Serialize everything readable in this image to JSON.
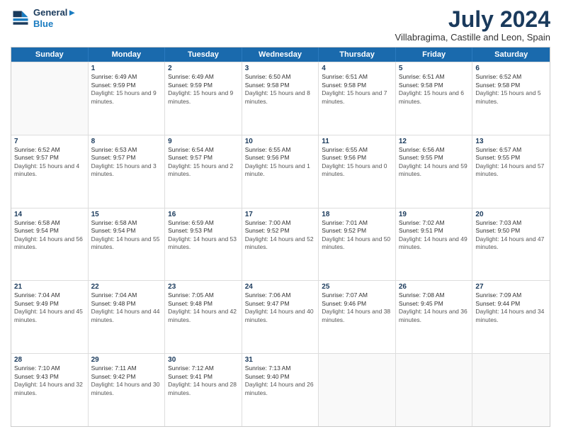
{
  "logo": {
    "line1": "General",
    "line2": "Blue"
  },
  "title": "July 2024",
  "subtitle": "Villabragima, Castille and Leon, Spain",
  "headers": [
    "Sunday",
    "Monday",
    "Tuesday",
    "Wednesday",
    "Thursday",
    "Friday",
    "Saturday"
  ],
  "weeks": [
    [
      {
        "day": "",
        "sunrise": "",
        "sunset": "",
        "daylight": ""
      },
      {
        "day": "1",
        "sunrise": "Sunrise: 6:49 AM",
        "sunset": "Sunset: 9:59 PM",
        "daylight": "Daylight: 15 hours and 9 minutes."
      },
      {
        "day": "2",
        "sunrise": "Sunrise: 6:49 AM",
        "sunset": "Sunset: 9:59 PM",
        "daylight": "Daylight: 15 hours and 9 minutes."
      },
      {
        "day": "3",
        "sunrise": "Sunrise: 6:50 AM",
        "sunset": "Sunset: 9:58 PM",
        "daylight": "Daylight: 15 hours and 8 minutes."
      },
      {
        "day": "4",
        "sunrise": "Sunrise: 6:51 AM",
        "sunset": "Sunset: 9:58 PM",
        "daylight": "Daylight: 15 hours and 7 minutes."
      },
      {
        "day": "5",
        "sunrise": "Sunrise: 6:51 AM",
        "sunset": "Sunset: 9:58 PM",
        "daylight": "Daylight: 15 hours and 6 minutes."
      },
      {
        "day": "6",
        "sunrise": "Sunrise: 6:52 AM",
        "sunset": "Sunset: 9:58 PM",
        "daylight": "Daylight: 15 hours and 5 minutes."
      }
    ],
    [
      {
        "day": "7",
        "sunrise": "Sunrise: 6:52 AM",
        "sunset": "Sunset: 9:57 PM",
        "daylight": "Daylight: 15 hours and 4 minutes."
      },
      {
        "day": "8",
        "sunrise": "Sunrise: 6:53 AM",
        "sunset": "Sunset: 9:57 PM",
        "daylight": "Daylight: 15 hours and 3 minutes."
      },
      {
        "day": "9",
        "sunrise": "Sunrise: 6:54 AM",
        "sunset": "Sunset: 9:57 PM",
        "daylight": "Daylight: 15 hours and 2 minutes."
      },
      {
        "day": "10",
        "sunrise": "Sunrise: 6:55 AM",
        "sunset": "Sunset: 9:56 PM",
        "daylight": "Daylight: 15 hours and 1 minute."
      },
      {
        "day": "11",
        "sunrise": "Sunrise: 6:55 AM",
        "sunset": "Sunset: 9:56 PM",
        "daylight": "Daylight: 15 hours and 0 minutes."
      },
      {
        "day": "12",
        "sunrise": "Sunrise: 6:56 AM",
        "sunset": "Sunset: 9:55 PM",
        "daylight": "Daylight: 14 hours and 59 minutes."
      },
      {
        "day": "13",
        "sunrise": "Sunrise: 6:57 AM",
        "sunset": "Sunset: 9:55 PM",
        "daylight": "Daylight: 14 hours and 57 minutes."
      }
    ],
    [
      {
        "day": "14",
        "sunrise": "Sunrise: 6:58 AM",
        "sunset": "Sunset: 9:54 PM",
        "daylight": "Daylight: 14 hours and 56 minutes."
      },
      {
        "day": "15",
        "sunrise": "Sunrise: 6:58 AM",
        "sunset": "Sunset: 9:54 PM",
        "daylight": "Daylight: 14 hours and 55 minutes."
      },
      {
        "day": "16",
        "sunrise": "Sunrise: 6:59 AM",
        "sunset": "Sunset: 9:53 PM",
        "daylight": "Daylight: 14 hours and 53 minutes."
      },
      {
        "day": "17",
        "sunrise": "Sunrise: 7:00 AM",
        "sunset": "Sunset: 9:52 PM",
        "daylight": "Daylight: 14 hours and 52 minutes."
      },
      {
        "day": "18",
        "sunrise": "Sunrise: 7:01 AM",
        "sunset": "Sunset: 9:52 PM",
        "daylight": "Daylight: 14 hours and 50 minutes."
      },
      {
        "day": "19",
        "sunrise": "Sunrise: 7:02 AM",
        "sunset": "Sunset: 9:51 PM",
        "daylight": "Daylight: 14 hours and 49 minutes."
      },
      {
        "day": "20",
        "sunrise": "Sunrise: 7:03 AM",
        "sunset": "Sunset: 9:50 PM",
        "daylight": "Daylight: 14 hours and 47 minutes."
      }
    ],
    [
      {
        "day": "21",
        "sunrise": "Sunrise: 7:04 AM",
        "sunset": "Sunset: 9:49 PM",
        "daylight": "Daylight: 14 hours and 45 minutes."
      },
      {
        "day": "22",
        "sunrise": "Sunrise: 7:04 AM",
        "sunset": "Sunset: 9:48 PM",
        "daylight": "Daylight: 14 hours and 44 minutes."
      },
      {
        "day": "23",
        "sunrise": "Sunrise: 7:05 AM",
        "sunset": "Sunset: 9:48 PM",
        "daylight": "Daylight: 14 hours and 42 minutes."
      },
      {
        "day": "24",
        "sunrise": "Sunrise: 7:06 AM",
        "sunset": "Sunset: 9:47 PM",
        "daylight": "Daylight: 14 hours and 40 minutes."
      },
      {
        "day": "25",
        "sunrise": "Sunrise: 7:07 AM",
        "sunset": "Sunset: 9:46 PM",
        "daylight": "Daylight: 14 hours and 38 minutes."
      },
      {
        "day": "26",
        "sunrise": "Sunrise: 7:08 AM",
        "sunset": "Sunset: 9:45 PM",
        "daylight": "Daylight: 14 hours and 36 minutes."
      },
      {
        "day": "27",
        "sunrise": "Sunrise: 7:09 AM",
        "sunset": "Sunset: 9:44 PM",
        "daylight": "Daylight: 14 hours and 34 minutes."
      }
    ],
    [
      {
        "day": "28",
        "sunrise": "Sunrise: 7:10 AM",
        "sunset": "Sunset: 9:43 PM",
        "daylight": "Daylight: 14 hours and 32 minutes."
      },
      {
        "day": "29",
        "sunrise": "Sunrise: 7:11 AM",
        "sunset": "Sunset: 9:42 PM",
        "daylight": "Daylight: 14 hours and 30 minutes."
      },
      {
        "day": "30",
        "sunrise": "Sunrise: 7:12 AM",
        "sunset": "Sunset: 9:41 PM",
        "daylight": "Daylight: 14 hours and 28 minutes."
      },
      {
        "day": "31",
        "sunrise": "Sunrise: 7:13 AM",
        "sunset": "Sunset: 9:40 PM",
        "daylight": "Daylight: 14 hours and 26 minutes."
      },
      {
        "day": "",
        "sunrise": "",
        "sunset": "",
        "daylight": ""
      },
      {
        "day": "",
        "sunrise": "",
        "sunset": "",
        "daylight": ""
      },
      {
        "day": "",
        "sunrise": "",
        "sunset": "",
        "daylight": ""
      }
    ]
  ]
}
